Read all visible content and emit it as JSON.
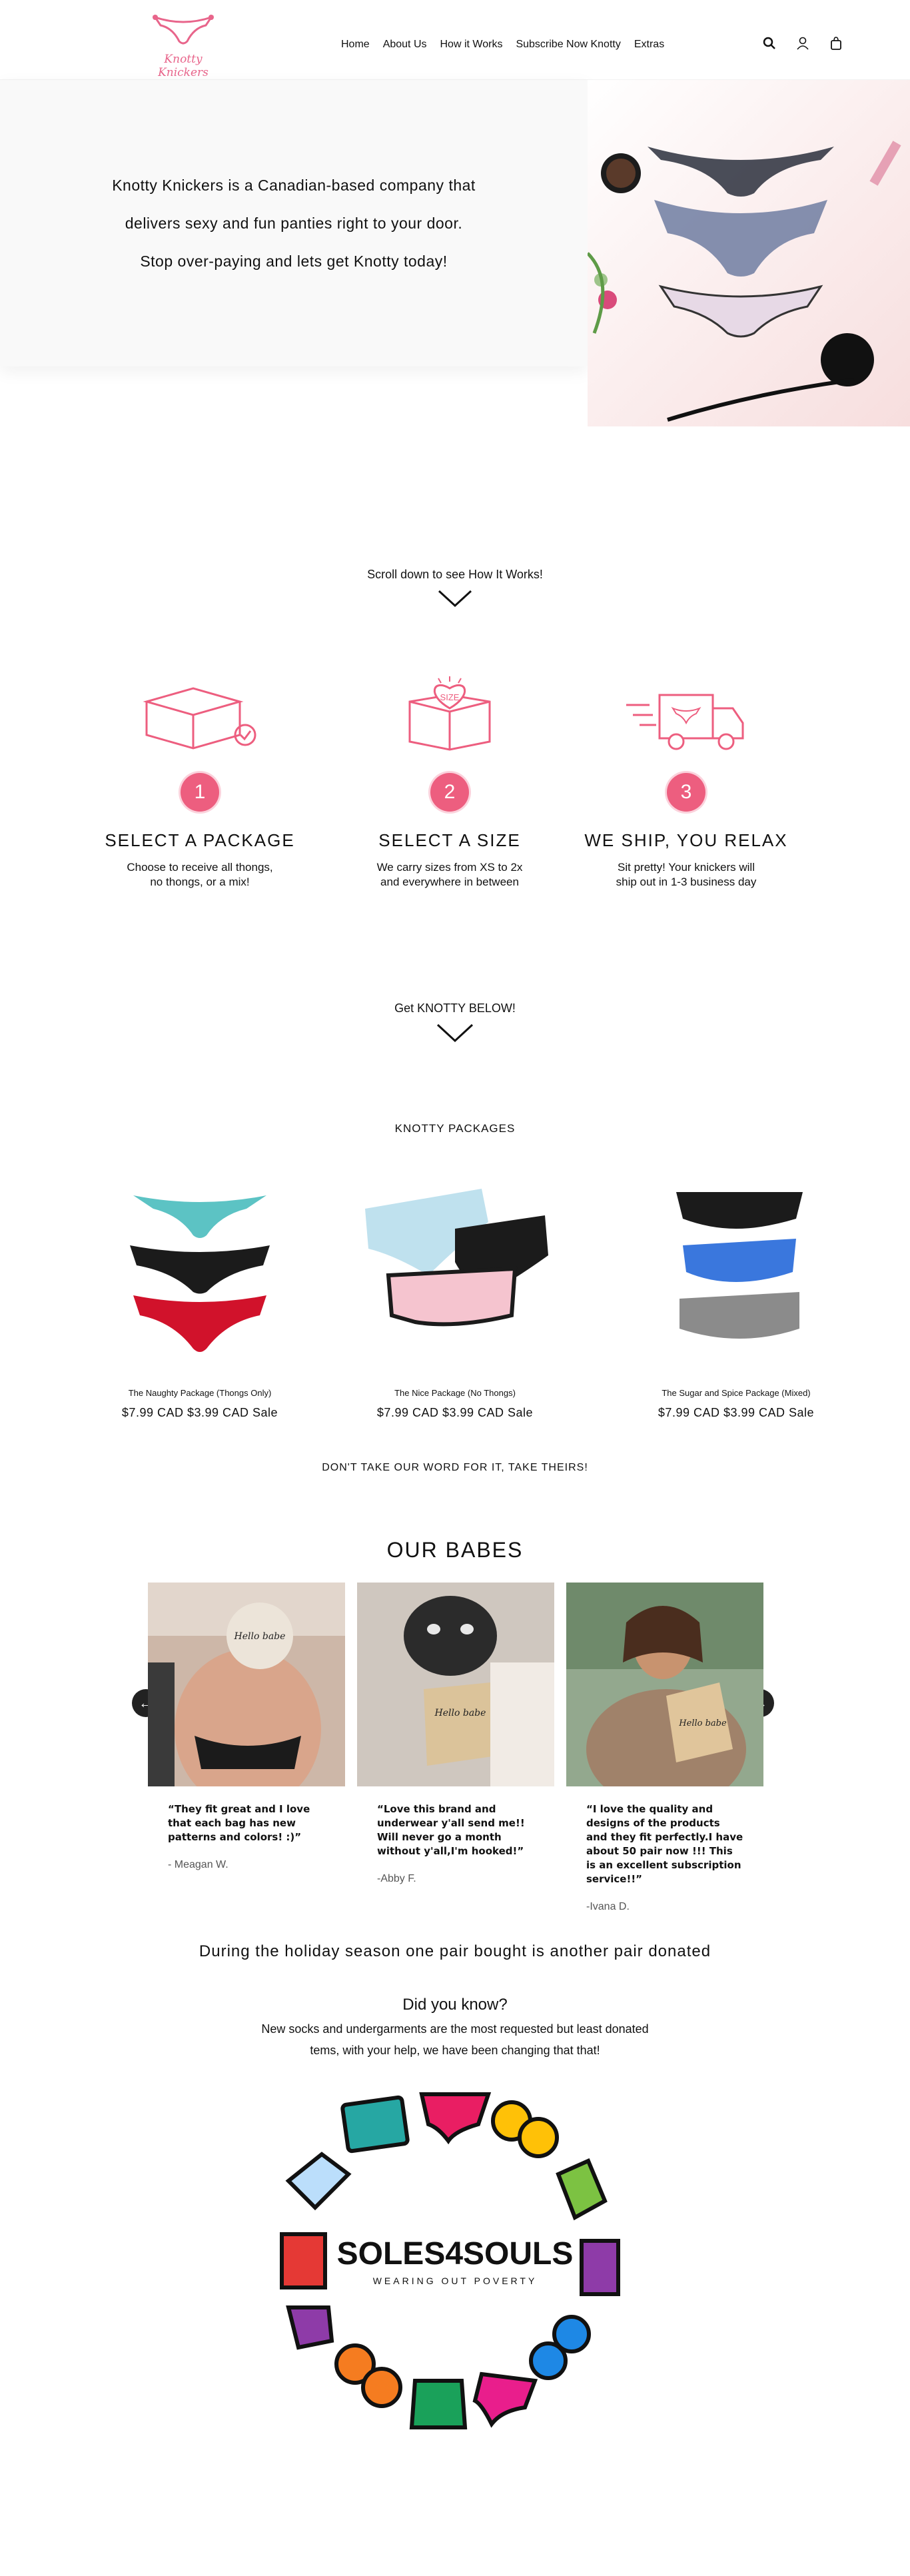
{
  "brand": {
    "name": "Knotty Knickers",
    "accent": "#ed5e7f"
  },
  "nav": {
    "items": [
      "Home",
      "About Us",
      "How it Works",
      "Subscribe Now Knotty",
      "Extras"
    ],
    "icons": [
      "search-icon",
      "account-icon",
      "cart-icon"
    ]
  },
  "hero": {
    "lines": [
      "Knotty Knickers is a Canadian-based  company that",
      "delivers sexy and fun panties right to your door.",
      "Stop over-paying and lets get  Knotty today!"
    ]
  },
  "scroll_hint": "Scroll down to see How It Works!",
  "steps": [
    {
      "num": "1",
      "title": "SELECT A PACKAGE",
      "desc": "Choose to receive all thongs,\nno thongs, or a mix!",
      "icon": "box-check-icon"
    },
    {
      "num": "2",
      "title": "SELECT A SIZE",
      "desc": "We carry sizes from XS to 2x\nand everywhere in between",
      "icon": "size-box-icon",
      "icon_label": "SIZE"
    },
    {
      "num": "3",
      "title": "WE SHIP, YOU RELAX",
      "desc": "Sit pretty! Your knickers will\nship out in 1-3 business day",
      "icon": "delivery-truck-icon"
    }
  ],
  "get_knotty": "Get KNOTTY BELOW!",
  "packages": {
    "heading": "KNOTTY PACKAGES",
    "items": [
      {
        "name": "The Naughty Package (Thongs Only)",
        "price": "$7.99 CAD $3.99 CAD Sale"
      },
      {
        "name": "The Nice Package (No Thongs)",
        "price": "$7.99 CAD $3.99 CAD Sale"
      },
      {
        "name": "The Sugar and Spice Package (Mixed)",
        "price": "$7.99 CAD $3.99 CAD Sale"
      }
    ]
  },
  "reviews": {
    "heading": "DON'T TAKE OUR WORD FOR IT, TAKE THEIRS!",
    "title": "OUR BABES",
    "prev": "←",
    "next": "→",
    "items": [
      {
        "quote": "“They fit great and I love that each bag has new patterns and colors! :)”",
        "author": "- Meagan W."
      },
      {
        "quote": "“Love this brand and underwear y'all send me!! Will never go a month without y'all,I'm hooked!”",
        "author": "-Abby F."
      },
      {
        "quote": "“I love the quality and designs of the products and they fit perfectly.I have about 50 pair now !!! This is an excellent subscription service!!”",
        "author": "-Ivana D."
      }
    ]
  },
  "donation": {
    "headline": "During the holiday season one pair bought is another pair donated",
    "question": "Did you know?",
    "lines": [
      "New socks and undergarments are the most requested but least donated",
      "tems,  with your help, we have been changing that that!"
    ],
    "logo_text": "SOLES4SOULS",
    "logo_tagline": "WEARING OUT POVERTY"
  }
}
